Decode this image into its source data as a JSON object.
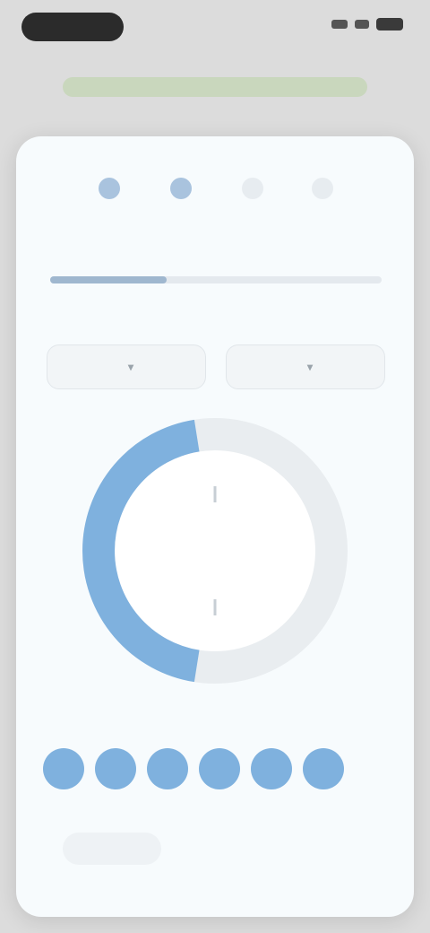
{
  "status_bar": {
    "time": ""
  },
  "wizard": {
    "title": "",
    "progress_percent": 35,
    "steps": [
      {
        "name": "step-1",
        "state": "done"
      },
      {
        "name": "step-2",
        "state": "active"
      },
      {
        "name": "step-3",
        "state": "pending"
      },
      {
        "name": "step-4",
        "state": "pending"
      }
    ]
  },
  "schedule": {
    "field_label": "",
    "start_time": "",
    "end_time": "",
    "dial_top_label": "",
    "dial_center_label": "",
    "dial_bottom_label": "",
    "dial_fill_fraction": 0.45
  },
  "days": {
    "label": "",
    "items": [
      "",
      "",
      "",
      "",
      "",
      "",
      ""
    ]
  },
  "actions": {
    "next_label": ""
  },
  "colors": {
    "accent": "#7fb1de",
    "dial_track": "#e9edf0",
    "banner": "#c9d7bd"
  }
}
